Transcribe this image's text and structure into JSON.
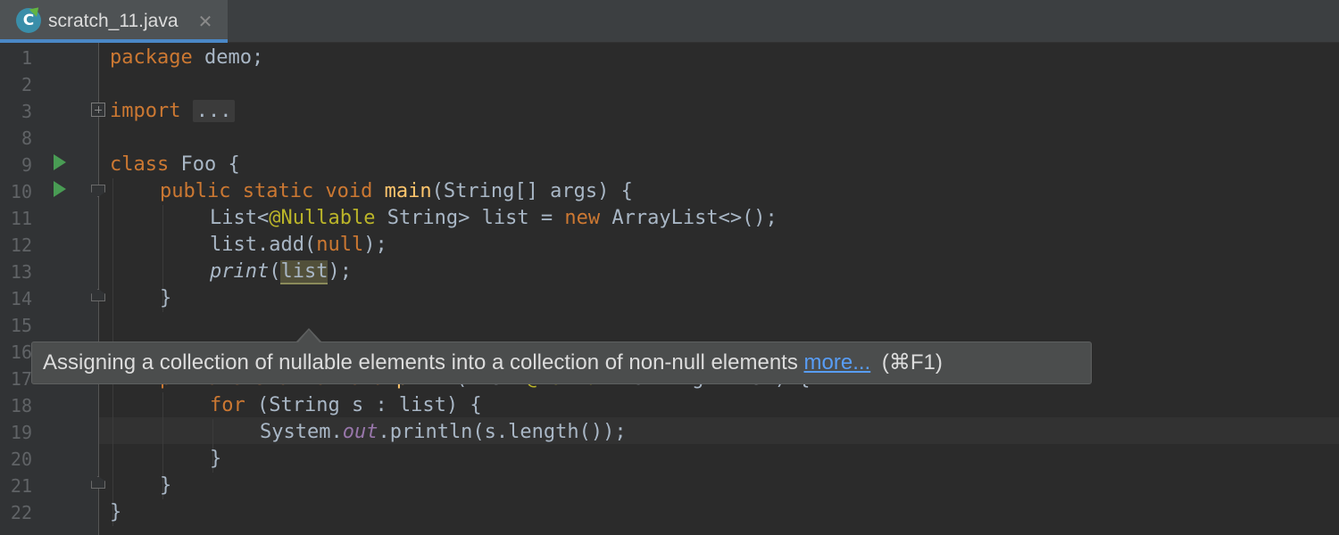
{
  "tab": {
    "icon_letter": "C",
    "file_name": "scratch_11.java",
    "close_glyph": "✕"
  },
  "gutter": {
    "line_numbers": [
      "1",
      "2",
      "3",
      "8",
      "9",
      "10",
      "11",
      "12",
      "13",
      "14",
      "15",
      "16",
      "17",
      "18",
      "19",
      "20",
      "21",
      "22"
    ]
  },
  "code": {
    "l1": {
      "kw": "package",
      "rest": " demo;"
    },
    "l3": {
      "kw": "import",
      "folded": "..."
    },
    "l9": {
      "kw": "class",
      "rest": " Foo {"
    },
    "l10": {
      "kw": "public static void",
      "fn": "main",
      "rest": "(String[] args) {"
    },
    "l11": {
      "a": "List<",
      "ann": "@Nullable",
      "b": " String> list = ",
      "kw": "new",
      "c": " ArrayList<>();"
    },
    "l12": {
      "a": "list.add(",
      "kw": "null",
      "b": ");"
    },
    "l13": {
      "fn": "print",
      "a": "(",
      "hl": "list",
      "b": ");"
    },
    "l14": {
      "text": "}"
    },
    "l17": {
      "kw": "private static void",
      "fn": "print",
      "a": "(List<",
      "ann": "@NotNull",
      "b": " String> list) {"
    },
    "l18": {
      "kw": "for",
      "rest": " (String s : list) {"
    },
    "l19": {
      "a": "System.",
      "field": "out",
      "b": ".println(s.length());"
    },
    "l20": {
      "text": "}"
    },
    "l21": {
      "text": "}"
    },
    "l22": {
      "text": "}"
    }
  },
  "tooltip": {
    "message": "Assigning a collection of nullable elements into a collection of non-null elements",
    "link": "more...",
    "shortcut": "(⌘F1)"
  },
  "colors": {
    "background": "#2b2b2b",
    "keyword": "#cc7832",
    "annotation": "#bbb529",
    "function": "#ffc66d",
    "field": "#9876aa",
    "link": "#589df6"
  }
}
